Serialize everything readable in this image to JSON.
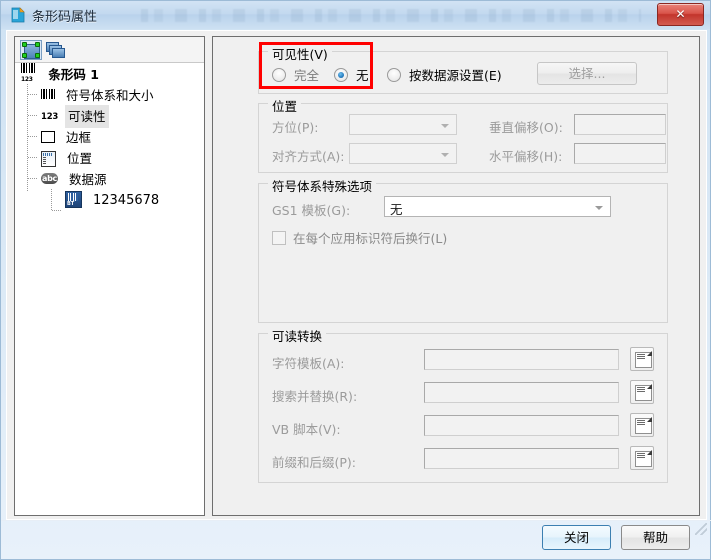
{
  "window": {
    "title": "条形码属性",
    "close_button_label": "✕",
    "title_icon": "document-page-icon"
  },
  "tree": {
    "toolbar": [
      {
        "name": "object-select-tool",
        "label": "选择对象"
      },
      {
        "name": "layers-tool",
        "label": "图层"
      }
    ],
    "nodes": [
      {
        "label": "条形码 1",
        "level": 0,
        "icon": "barcode-icon",
        "selected": false
      },
      {
        "label": "符号体系和大小",
        "level": 1,
        "icon": "barcode-bars-icon",
        "selected": false
      },
      {
        "label": "可读性",
        "level": 1,
        "icon": "numbers-123-icon",
        "selected": true
      },
      {
        "label": "边框",
        "level": 1,
        "icon": "rectangle-border-icon",
        "selected": false
      },
      {
        "label": "位置",
        "level": 1,
        "icon": "ruler-position-icon",
        "selected": false
      },
      {
        "label": "数据源",
        "level": 1,
        "icon": "abc-datasource-icon",
        "selected": false
      },
      {
        "label": "12345678",
        "level": 2,
        "icon": "barcode-data-icon",
        "selected": false
      }
    ]
  },
  "visibility": {
    "group_label": "可见性(V)",
    "options": [
      {
        "label": "完全",
        "checked": false
      },
      {
        "label": "无",
        "checked": true
      },
      {
        "label": "按数据源设置(E)",
        "checked": false
      }
    ],
    "select_button": "选择..."
  },
  "position": {
    "group_label": "位置",
    "orientation_label": "方位(P):",
    "orientation_value": "",
    "alignment_label": "对齐方式(A):",
    "alignment_value": "",
    "vertical_offset_label": "垂直偏移(O):",
    "vertical_offset_value": "",
    "horizontal_offset_label": "水平偏移(H):",
    "horizontal_offset_value": ""
  },
  "symbology": {
    "group_label": "符号体系特殊选项",
    "gs1_template_label": "GS1 模板(G):",
    "gs1_template_value": "无",
    "line_break_checkbox": "在每个应用标识符后换行(L)",
    "line_break_mnemonic": "(L)",
    "line_break_text": "在每个应用标识符后换行"
  },
  "readable": {
    "group_label": "可读转换",
    "rows": [
      {
        "label": "字符模板(A):",
        "value": "",
        "browse": "browse-icon"
      },
      {
        "label": "搜索并替换(R):",
        "value": "",
        "browse": "browse-icon"
      },
      {
        "label": "VB 脚本(V):",
        "value": "",
        "browse": "browse-icon"
      },
      {
        "label": "前缀和后缀(P):",
        "value": "",
        "browse": "browse-icon"
      }
    ]
  },
  "footer": {
    "close_label": "关闭",
    "help_label": "帮助"
  },
  "colors": {
    "annotation": "#ff0000",
    "titlebar_start": "#d2e3f4",
    "close_red": "#c2352c",
    "radio_blue": "#1b72b8",
    "default_button_border": "#3c7fb1"
  }
}
